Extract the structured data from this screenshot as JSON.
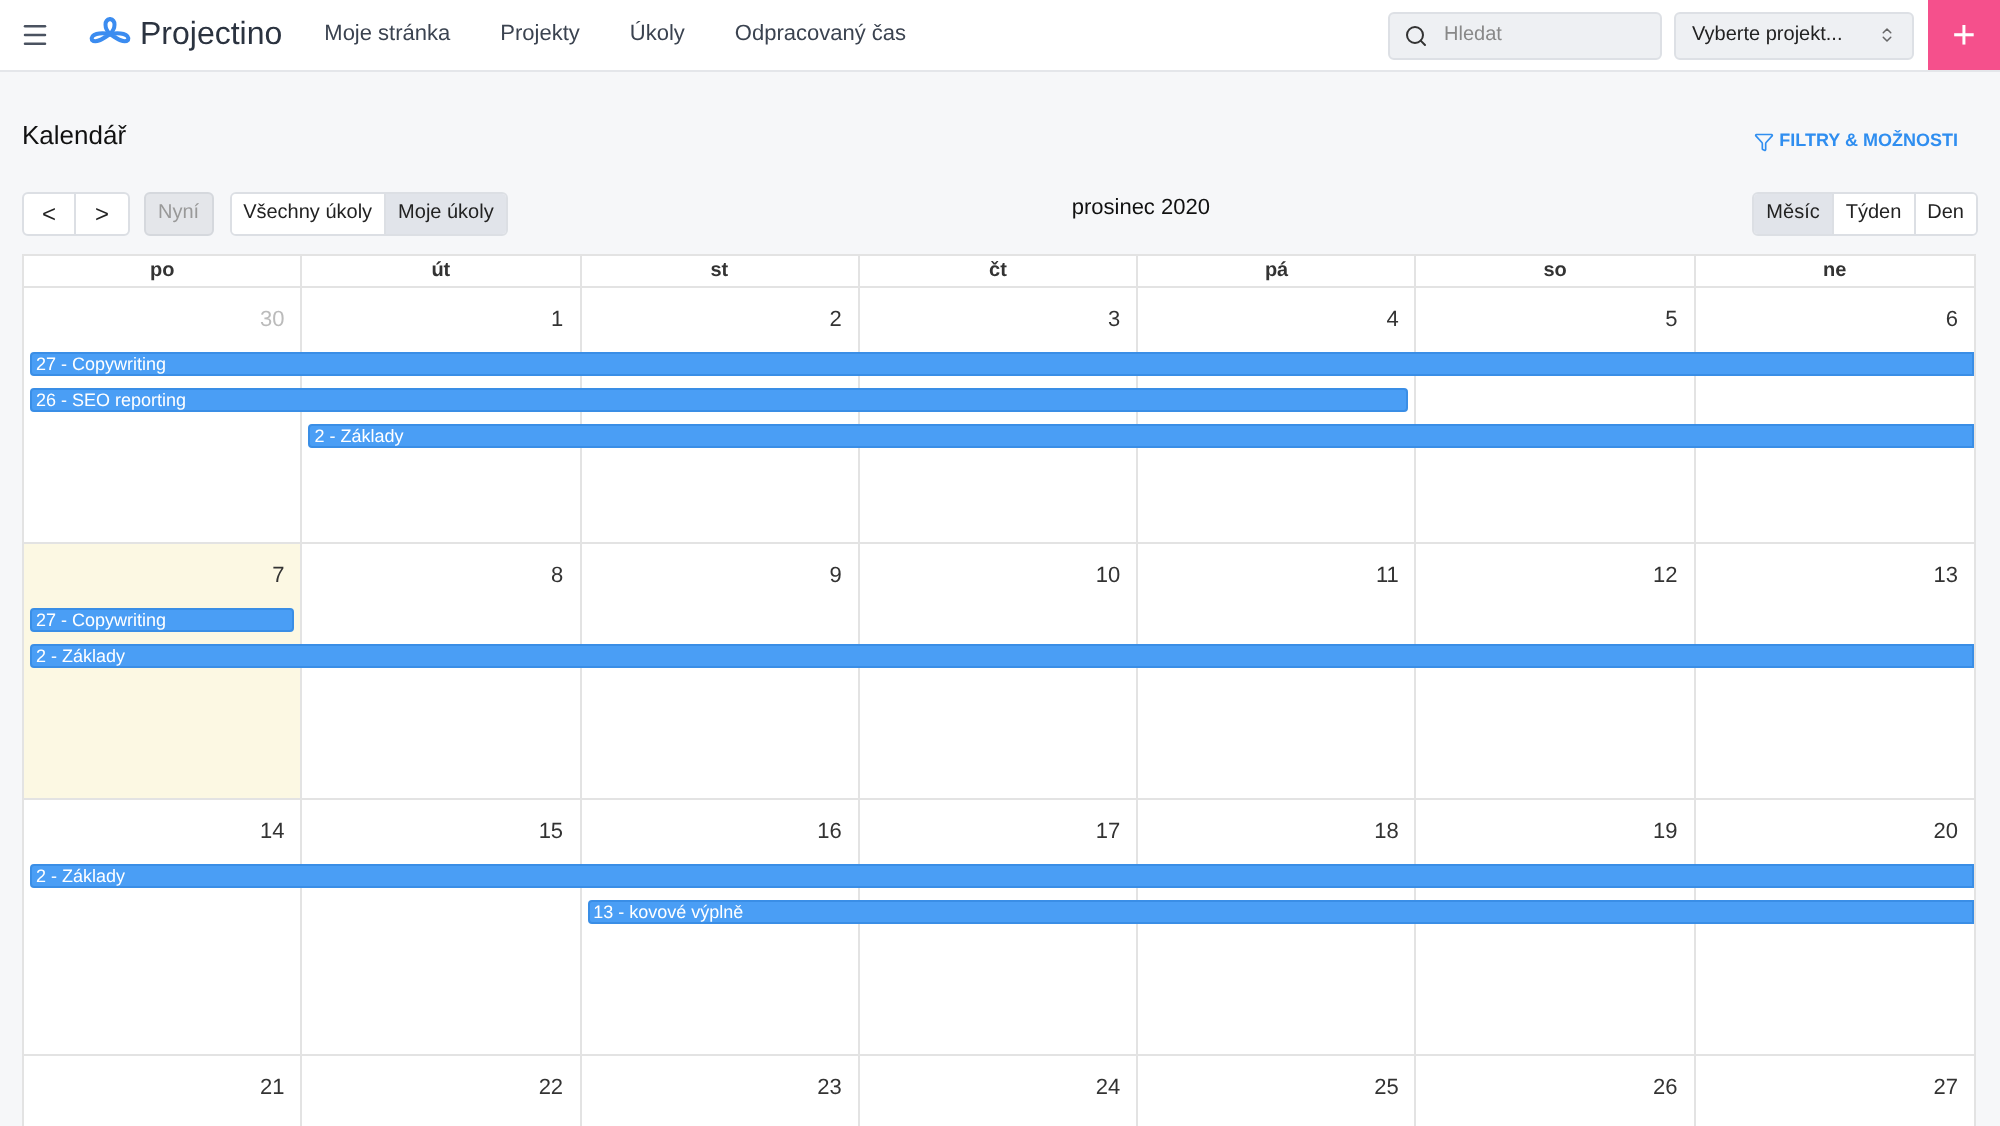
{
  "nav": {
    "brand": "Projectino",
    "links": [
      "Moje stránka",
      "Projekty",
      "Úkoly",
      "Odpracovaný čas"
    ],
    "search": {
      "placeholder": "Hledat"
    },
    "project_select": {
      "value": "Vyberte projekt..."
    },
    "add_button": "+"
  },
  "page": {
    "title": "Kalendář",
    "filter_link": "FILTRY & MOŽNOSTI"
  },
  "toolbar": {
    "prev": "<",
    "next": ">",
    "now": {
      "label": "Nyní",
      "disabled": true
    },
    "scope_tabs": [
      {
        "label": "Všechny úkoly",
        "selected": false
      },
      {
        "label": "Moje úkoly",
        "selected": true
      }
    ],
    "month_title": "prosinec 2020",
    "view_tabs": [
      {
        "label": "Měsíc",
        "selected": true
      },
      {
        "label": "Týden",
        "selected": false
      },
      {
        "label": "Den",
        "selected": false
      }
    ]
  },
  "calendar": {
    "weekdays": [
      "po",
      "út",
      "st",
      "čt",
      "pá",
      "so",
      "ne"
    ],
    "weeks": [
      {
        "days": [
          {
            "label": "30",
            "other_month": true,
            "today": false
          },
          {
            "label": "1",
            "other_month": false,
            "today": false
          },
          {
            "label": "2",
            "other_month": false,
            "today": false
          },
          {
            "label": "3",
            "other_month": false,
            "today": false
          },
          {
            "label": "4",
            "other_month": false,
            "today": false
          },
          {
            "label": "5",
            "other_month": false,
            "today": false
          },
          {
            "label": "6",
            "other_month": false,
            "today": false
          }
        ],
        "lanes": [
          [
            {
              "kind": "bar",
              "title": "27 - Copywriting",
              "continues": true
            },
            {
              "kind": "more"
            },
            {
              "kind": "more"
            },
            {
              "kind": "more"
            },
            {
              "kind": "more"
            },
            {
              "kind": "more"
            },
            {
              "kind": "more"
            }
          ],
          [
            {
              "kind": "bar",
              "title": "26 - SEO reporting",
              "continues": false
            },
            {
              "kind": "more"
            },
            {
              "kind": "more"
            },
            {
              "kind": "more"
            },
            {
              "kind": "more"
            },
            {
              "kind": "empty"
            },
            {
              "kind": "empty"
            }
          ],
          [
            {
              "kind": "empty"
            },
            {
              "kind": "bar",
              "title": "2 - Základy",
              "continues": true
            },
            {
              "kind": "more"
            },
            {
              "kind": "more"
            },
            {
              "kind": "more"
            },
            {
              "kind": "more"
            },
            {
              "kind": "more"
            }
          ]
        ]
      },
      {
        "days": [
          {
            "label": "7",
            "other_month": false,
            "today": true
          },
          {
            "label": "8",
            "other_month": false,
            "today": false
          },
          {
            "label": "9",
            "other_month": false,
            "today": false
          },
          {
            "label": "10",
            "other_month": false,
            "today": false
          },
          {
            "label": "11",
            "other_month": false,
            "today": false
          },
          {
            "label": "12",
            "other_month": false,
            "today": false
          },
          {
            "label": "13",
            "other_month": false,
            "today": false
          }
        ],
        "lanes": [
          [
            {
              "kind": "bar",
              "title": "27 - Copywriting",
              "continues": false
            },
            {
              "kind": "empty"
            },
            {
              "kind": "empty"
            },
            {
              "kind": "empty"
            },
            {
              "kind": "empty"
            },
            {
              "kind": "empty"
            },
            {
              "kind": "empty"
            }
          ],
          [
            {
              "kind": "bar",
              "title": "2 - Základy",
              "continues": true
            },
            {
              "kind": "more"
            },
            {
              "kind": "more"
            },
            {
              "kind": "more"
            },
            {
              "kind": "more"
            },
            {
              "kind": "more"
            },
            {
              "kind": "more"
            }
          ]
        ]
      },
      {
        "days": [
          {
            "label": "14",
            "other_month": false,
            "today": false
          },
          {
            "label": "15",
            "other_month": false,
            "today": false
          },
          {
            "label": "16",
            "other_month": false,
            "today": false
          },
          {
            "label": "17",
            "other_month": false,
            "today": false
          },
          {
            "label": "18",
            "other_month": false,
            "today": false
          },
          {
            "label": "19",
            "other_month": false,
            "today": false
          },
          {
            "label": "20",
            "other_month": false,
            "today": false
          }
        ],
        "lanes": [
          [
            {
              "kind": "bar",
              "title": "2 - Základy",
              "continues": true
            },
            {
              "kind": "more"
            },
            {
              "kind": "more"
            },
            {
              "kind": "more"
            },
            {
              "kind": "more"
            },
            {
              "kind": "more"
            },
            {
              "kind": "more"
            }
          ],
          [
            {
              "kind": "empty"
            },
            {
              "kind": "empty"
            },
            {
              "kind": "bar",
              "title": "13 - kovové výplně",
              "continues": true
            },
            {
              "kind": "more"
            },
            {
              "kind": "more"
            },
            {
              "kind": "more"
            },
            {
              "kind": "more"
            }
          ]
        ]
      },
      {
        "days": [
          {
            "label": "21",
            "other_month": false,
            "today": false
          },
          {
            "label": "22",
            "other_month": false,
            "today": false
          },
          {
            "label": "23",
            "other_month": false,
            "today": false
          },
          {
            "label": "24",
            "other_month": false,
            "today": false
          },
          {
            "label": "25",
            "other_month": false,
            "today": false
          },
          {
            "label": "26",
            "other_month": false,
            "today": false
          },
          {
            "label": "27",
            "other_month": false,
            "today": false
          }
        ]
      }
    ]
  }
}
